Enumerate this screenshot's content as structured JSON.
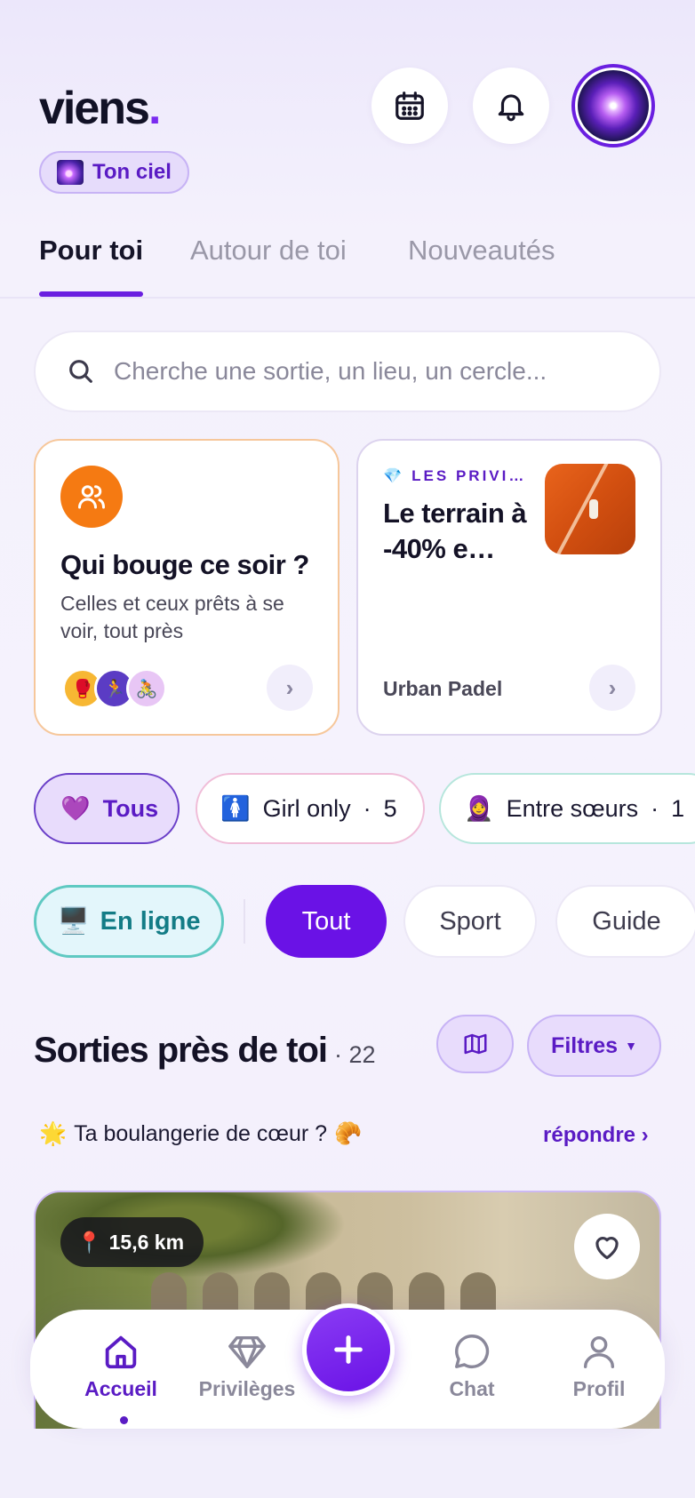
{
  "header": {
    "logo_text": "viens",
    "logo_dot": ".",
    "sky_pill_label": "Ton ciel",
    "calendar_icon": "calendar-icon",
    "bell_icon": "bell-icon"
  },
  "tabs": [
    {
      "label": "Pour toi",
      "active": true
    },
    {
      "label": "Autour de toi",
      "active": false
    },
    {
      "label": "Nouveautés",
      "active": false
    }
  ],
  "search": {
    "placeholder": "Cherche une sortie, un lieu, un cercle..."
  },
  "cards": {
    "nearby": {
      "title": "Qui bouge ce soir ?",
      "subtitle": "Celles et ceux prêts à se voir, tout près",
      "avatars": [
        "🥊",
        "🏃",
        "🚴"
      ]
    },
    "privilege": {
      "eyebrow": "LES PRIVI…",
      "title": "Le terrain à -40% e…",
      "place": "Urban Padel"
    }
  },
  "filters": {
    "audience": [
      {
        "emoji": "💜",
        "label": "Tous",
        "count": ""
      },
      {
        "emoji": "🚺",
        "label": "Girl only",
        "count": "5"
      },
      {
        "emoji": "🧕",
        "label": "Entre sœurs",
        "count": "1"
      }
    ],
    "online_label": "En ligne",
    "online_emoji": "🖥️",
    "categories": [
      "Tout",
      "Sport",
      "Guide"
    ]
  },
  "section": {
    "title": "Sorties près de toi",
    "count": "22",
    "filters_label": "Filtres",
    "map_icon": "map-icon"
  },
  "prompt": {
    "left_emoji": "🌟",
    "text": "Ta boulangerie de cœur ?",
    "right_emoji": "🥐",
    "link": "répondre ›"
  },
  "event": {
    "distance": "15,6 km",
    "pin_emoji": "📍"
  },
  "bottom_nav": [
    {
      "label": "Accueil",
      "icon": "home-icon",
      "active": true
    },
    {
      "label": "Privilèges",
      "icon": "diamond-icon",
      "active": false
    },
    {
      "label": "Chat",
      "icon": "chat-icon",
      "active": false
    },
    {
      "label": "Profil",
      "icon": "user-icon",
      "active": false
    }
  ],
  "colors": {
    "accent": "#6a12e6",
    "accent_text": "#5a1bc4",
    "orange": "#f57a12",
    "teal": "#137c86"
  }
}
